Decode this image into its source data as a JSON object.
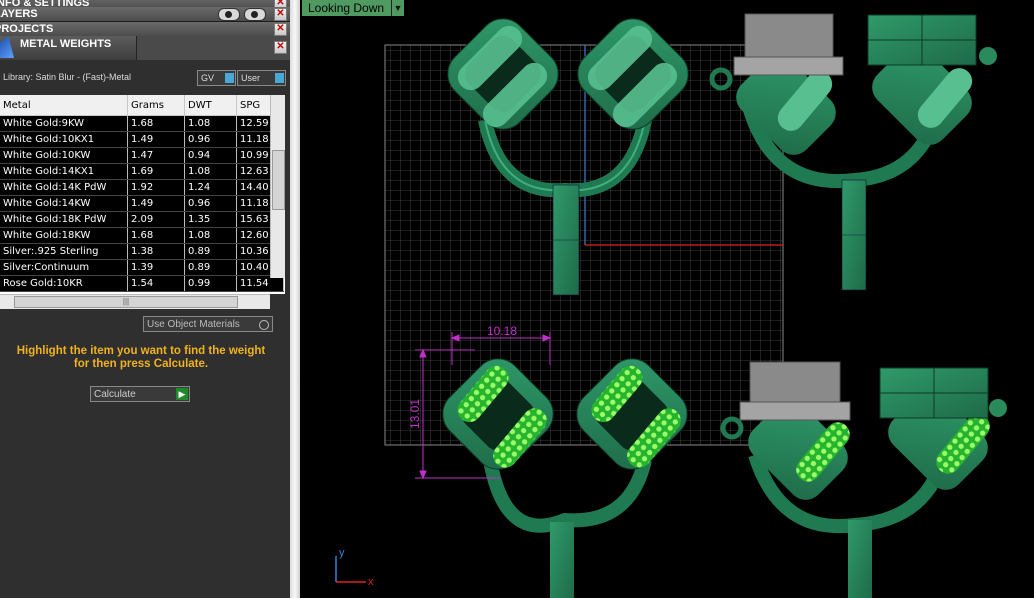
{
  "panels": {
    "info_settings": "INFO & SETTINGS",
    "layers": "LAYERS",
    "projects": "PROJECTS"
  },
  "metal_weights": {
    "title": "METAL WEIGHTS",
    "library": "Library: Satin Blur - (Fast)-Metal",
    "gv_label": "GV",
    "user_label": "User",
    "columns": [
      "Metal",
      "Grams",
      "DWT",
      "SPG"
    ],
    "rows": [
      [
        "White Gold:9KW",
        "1.68",
        "1.08",
        "12.59"
      ],
      [
        "White Gold:10KX1",
        "1.49",
        "0.96",
        "11.18"
      ],
      [
        "White Gold:10KW",
        "1.47",
        "0.94",
        "10.99"
      ],
      [
        "White Gold:14KX1",
        "1.69",
        "1.08",
        "12.63"
      ],
      [
        "White Gold:14K PdW",
        "1.92",
        "1.24",
        "14.40"
      ],
      [
        "White Gold:14KW",
        "1.49",
        "0.96",
        "11.18"
      ],
      [
        "White Gold:18K PdW",
        "2.09",
        "1.35",
        "15.63"
      ],
      [
        "White Gold:18KW",
        "1.68",
        "1.08",
        "12.60"
      ],
      [
        "Silver:.925 Sterling",
        "1.38",
        "0.89",
        "10.36"
      ],
      [
        "Silver:Continuum",
        "1.39",
        "0.89",
        "10.40"
      ],
      [
        "Rose Gold:10KR",
        "1.54",
        "0.99",
        "11.54"
      ]
    ],
    "use_object_materials": "Use Object Materials",
    "hint_line1": "Highlight the item you want to find the weight",
    "hint_line2": "for then press Calculate.",
    "calculate": "Calculate"
  },
  "viewport": {
    "view_name": "Looking Down",
    "dimension_width": "10.18",
    "dimension_height": "13.01",
    "axis_y": "y",
    "axis_x": "x"
  }
}
